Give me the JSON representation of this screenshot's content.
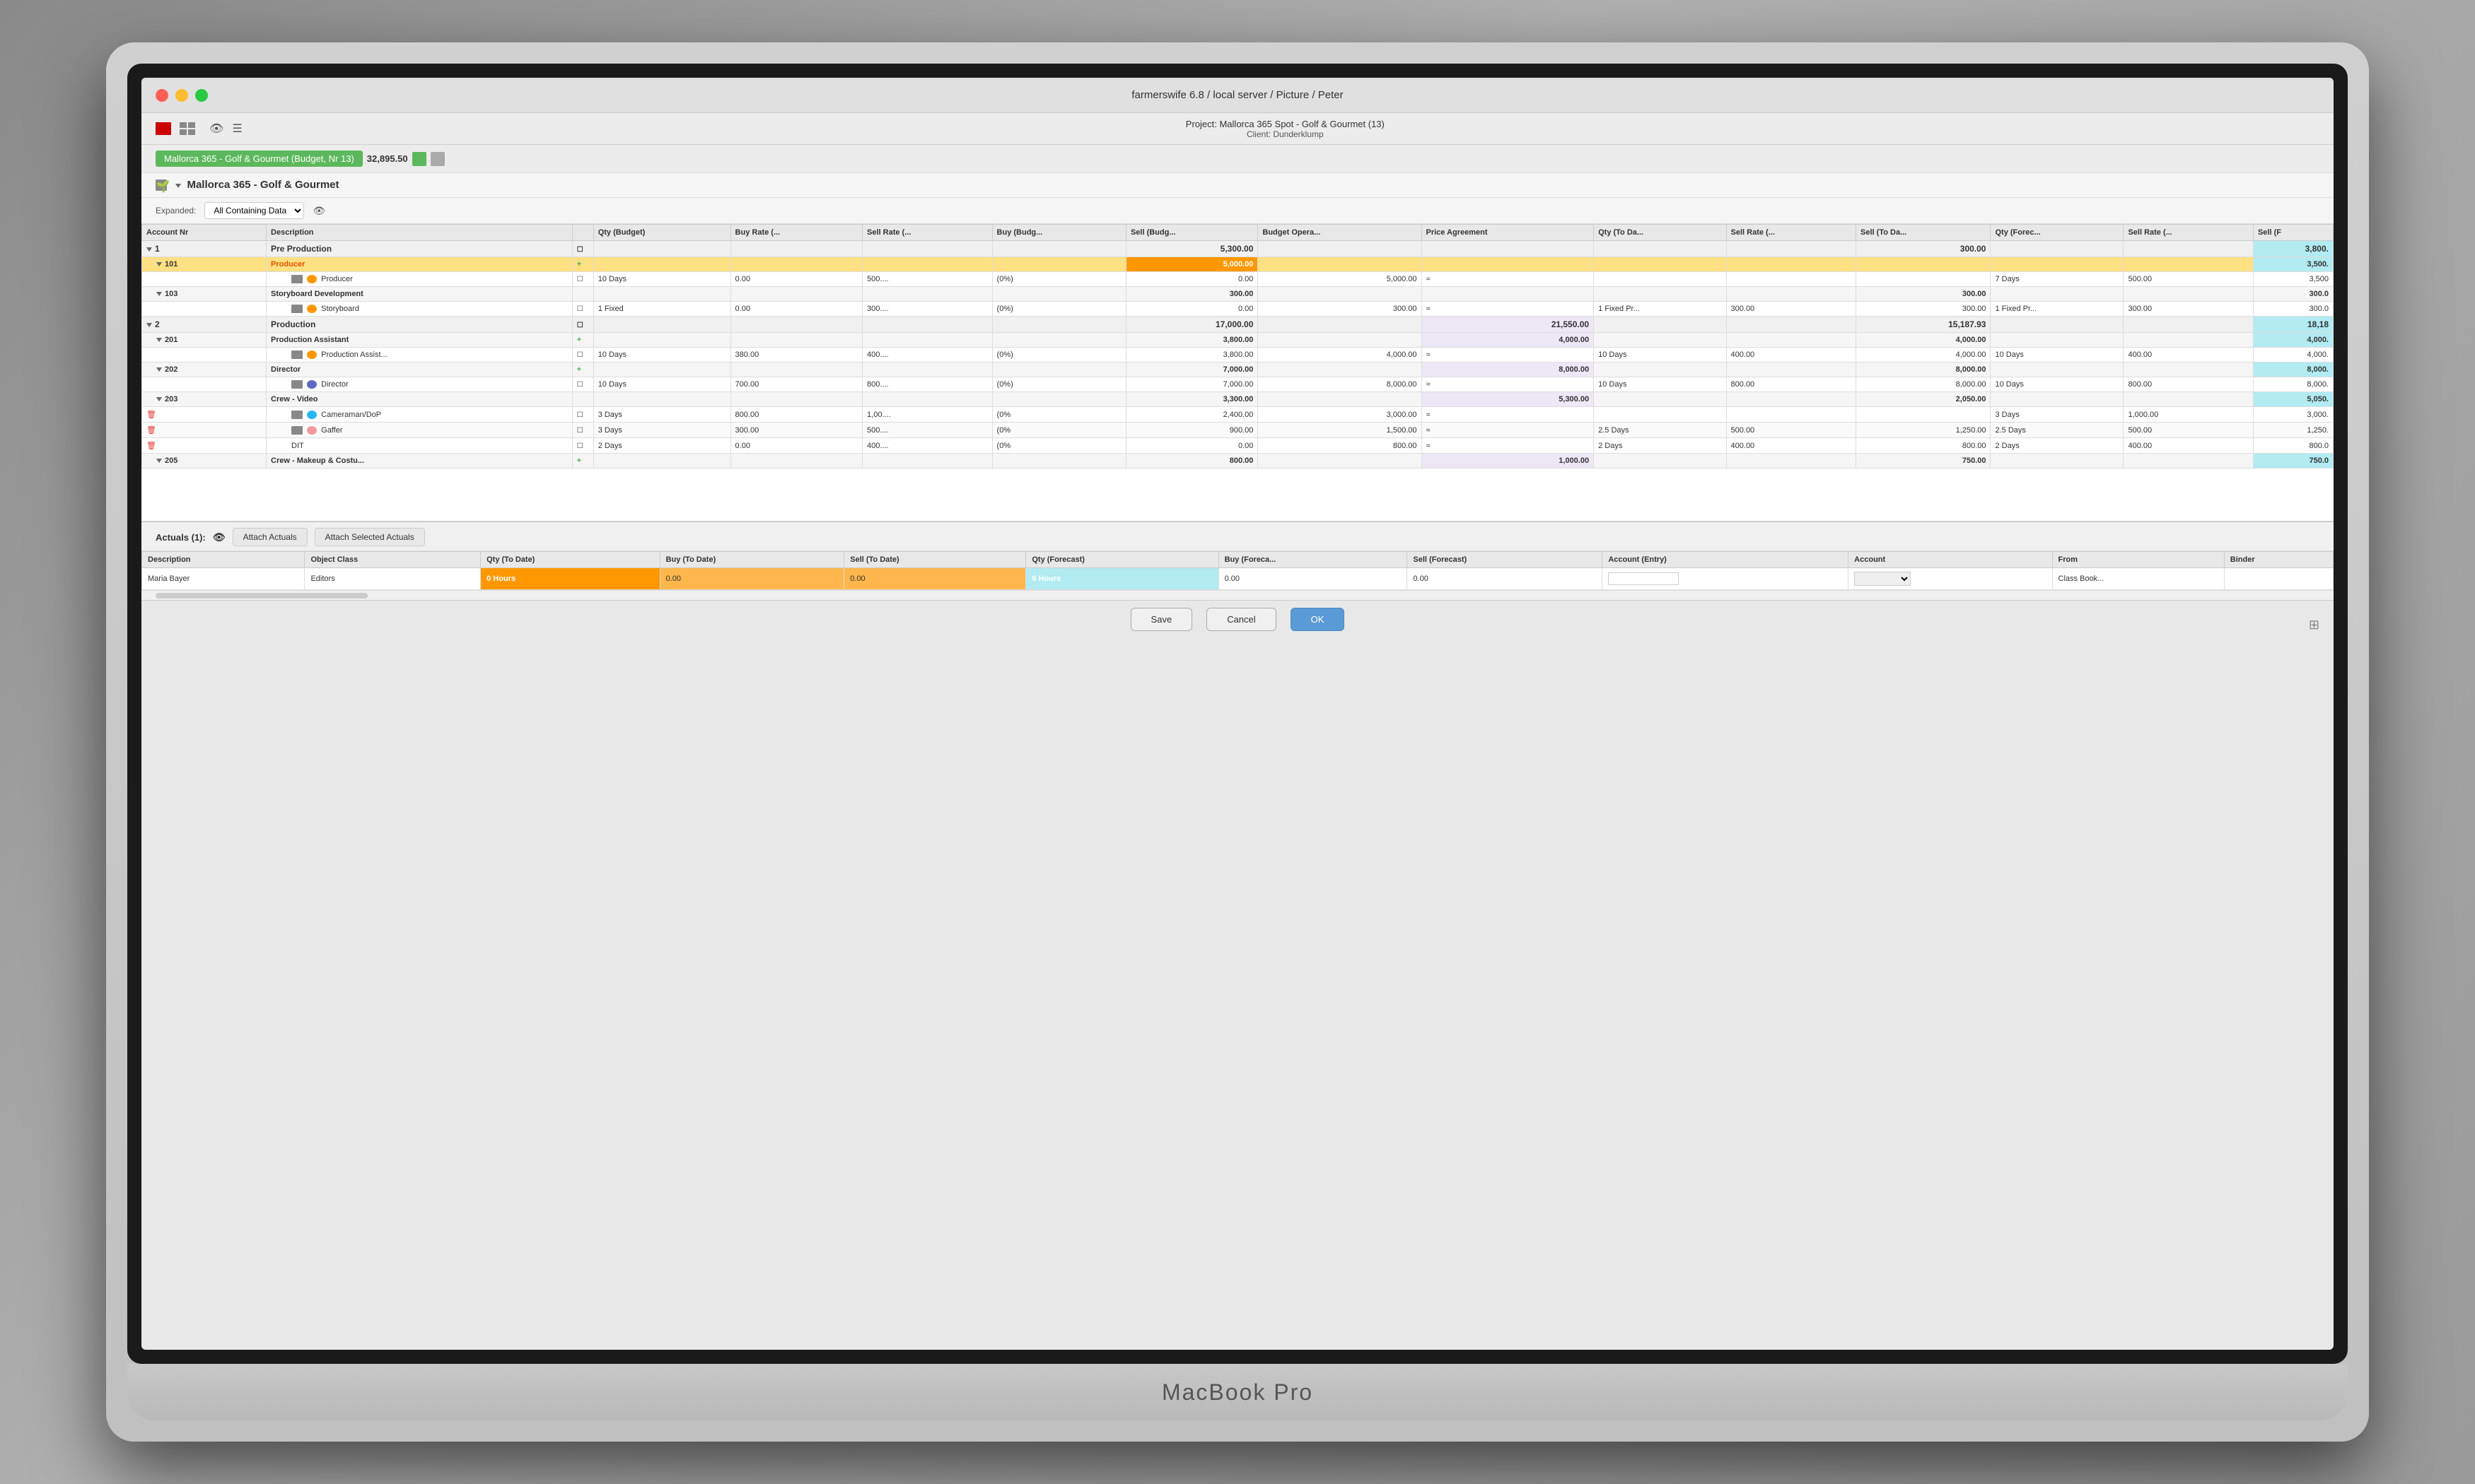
{
  "window": {
    "title": "farmerswife 6.8  / local server / Picture / Peter",
    "project_line1": "Project: Mallorca 365 Spot - Golf & Gourmet (13)",
    "project_line2": "Client: Dunderklump"
  },
  "toolbar": {
    "icons": [
      "red-square-icon",
      "grid-icon",
      "eye-icon",
      "list-icon"
    ]
  },
  "budget": {
    "tag_label": "Mallorca 365 - Golf & Gourmet (Budget, Nr 13)",
    "amount": "32,895.50"
  },
  "section": {
    "title": "Mallorca 365 - Golf & Gourmet"
  },
  "filter": {
    "expanded_label": "Expanded:",
    "option": "All Containing Data",
    "eye_icon": "👁"
  },
  "columns": {
    "headers": [
      "Account Nr",
      "Description",
      "",
      "Qty (Budget)",
      "Buy Rate (...",
      "Sell Rate (...",
      "Buy (Budg...",
      "Sell (Budg...",
      "Budget Opera...",
      "Price Agreement",
      "Qty (To Da...",
      "Sell Rate (...",
      "Sell (To Da...",
      "Qty (Forec...",
      "Sell Rate (... ",
      "Sell (F"
    ]
  },
  "rows": [
    {
      "type": "section",
      "id": "1",
      "description": "Pre Production",
      "sell_budget": "5,300.00",
      "sell_to_date": "300.00",
      "sell_forecast": "3,800."
    },
    {
      "type": "category",
      "id": "101",
      "description": "Producer",
      "sell_budget": "5,000.00",
      "sell_forecast": "3,500."
    },
    {
      "type": "item",
      "description": "Producer",
      "qty_budget": "10",
      "unit": "Days",
      "buy_rate": "0.00",
      "sell_rate": "500....",
      "pct": "(0%)",
      "buy_budget": "0.00",
      "sell_budget": "5,000.00",
      "qty_forecast": "7 Days",
      "sell_rate_f": "500.00",
      "sell_forecast": "3,500"
    },
    {
      "type": "sub_section",
      "id": "103",
      "description": "Storyboard Development",
      "sell_budget": "300.00",
      "sell_to_date": "300.00",
      "sell_forecast": "300.0"
    },
    {
      "type": "item",
      "description": "Storyboard",
      "qty_budget": "1",
      "unit": "Fixed",
      "buy_rate": "0.00",
      "sell_rate": "300....",
      "pct": "(0%)",
      "buy_budget": "0.00",
      "sell_budget": "300.00",
      "qty_to_date": "1 Fixed Pr...",
      "sell_rate_td": "300.00",
      "sell_to_date": "300.00",
      "qty_forecast": "1 Fixed Pr...",
      "sell_rate_f": "300.00",
      "sell_forecast": "300.0"
    },
    {
      "type": "section",
      "id": "2",
      "description": "Production",
      "sell_budget": "17,000.00",
      "sell_budget2": "21,550.00",
      "sell_to_date": "15,187.93",
      "sell_forecast": "18,18"
    },
    {
      "type": "sub_section",
      "id": "201",
      "description": "Production Assistant",
      "sell_budget": "3,800.00",
      "sell_budget2": "4,000.00",
      "sell_to_date": "4,000.00",
      "sell_forecast": "4,000."
    },
    {
      "type": "item",
      "description": "Production Assist...",
      "qty_budget": "10",
      "unit": "Days",
      "buy_rate": "380.00",
      "sell_rate": "400....",
      "pct": "(0%)",
      "buy_budget": "3,800.00",
      "sell_budget": "4,000.00",
      "qty_to_date": "10 Days",
      "sell_rate_td": "400.00",
      "sell_to_date": "4,000.00",
      "qty_forecast": "10 Days",
      "sell_rate_f": "400.00",
      "sell_forecast": "4,000."
    },
    {
      "type": "sub_section",
      "id": "202",
      "description": "Director",
      "sell_budget": "7,000.00",
      "sell_budget2": "8,000.00",
      "sell_to_date": "8,000.00",
      "sell_forecast": "8,000."
    },
    {
      "type": "item",
      "description": "Director",
      "qty_budget": "10",
      "unit": "Days",
      "buy_rate": "700.00",
      "sell_rate": "800....",
      "pct": "(0%)",
      "buy_budget": "7,000.00",
      "sell_budget": "8,000.00",
      "qty_to_date": "10 Days",
      "sell_rate_td": "800.00",
      "sell_to_date": "8,000.00",
      "qty_forecast": "10 Days",
      "sell_rate_f": "800.00",
      "sell_forecast": "8,000."
    },
    {
      "type": "sub_section",
      "id": "203",
      "description": "Crew - Video",
      "sell_budget": "3,300.00",
      "sell_budget2": "5,300.00",
      "sell_to_date": "2,050.00",
      "sell_forecast": "5,050."
    },
    {
      "type": "item",
      "description": "Cameraman/DoP",
      "qty_budget": "3",
      "unit": "Days",
      "buy_rate": "800.00",
      "sell_rate": "1,00....",
      "pct": "(0%",
      "buy_budget": "2,400.00",
      "sell_budget": "3,000.00",
      "qty_forecast": "3 Days",
      "sell_rate_f": "1,000.00",
      "sell_forecast": "3,000."
    },
    {
      "type": "item",
      "description": "Gaffer",
      "qty_budget": "3",
      "unit": "Days",
      "buy_rate": "300.00",
      "sell_rate": "500....",
      "pct": "(0%",
      "buy_budget": "900.00",
      "sell_budget": "1,500.00",
      "qty_to_date": "2.5 Days",
      "sell_rate_td": "500.00",
      "sell_to_date": "1,250.00",
      "qty_forecast": "2.5 Days",
      "sell_rate_f": "500.00",
      "sell_forecast": "1,250."
    },
    {
      "type": "item",
      "description": "DIT",
      "qty_budget": "2",
      "unit": "Days",
      "buy_rate": "0.00",
      "sell_rate": "400....",
      "pct": "(0%",
      "buy_budget": "0.00",
      "sell_budget": "800.00",
      "qty_to_date": "2 Days",
      "sell_rate_td": "400.00",
      "sell_to_date": "800.00",
      "qty_forecast": "2 Days",
      "sell_rate_f": "400.00",
      "sell_forecast": "800.0"
    },
    {
      "type": "sub_section",
      "id": "205",
      "description": "Crew - Makeup & Costu...",
      "sell_budget": "800.00",
      "sell_budget2": "1,000.00",
      "sell_to_date": "750.00",
      "sell_forecast": "750.0"
    }
  ],
  "actuals": {
    "header": "Actuals (1):",
    "search_placeholder": "",
    "btn_attach": "Attach Actuals",
    "btn_attach_selected": "Attach Selected Actuals",
    "columns": [
      "Description",
      "Object Class",
      "Qty (To Date)",
      "Buy (To Date)",
      "Sell (To Date)",
      "Qty (Forecast)",
      "Buy (Foreca...",
      "Sell (Forecast)",
      "Account (Entry)",
      "Account",
      "From",
      "Binder"
    ],
    "rows": [
      {
        "description": "Maria Bayer",
        "object_class": "Editors",
        "qty_to_date": "0 Hours",
        "buy_to_date": "0.00",
        "sell_to_date": "0.00",
        "qty_forecast": "8 Hours",
        "buy_forecast": "0.00",
        "sell_forecast": "0.00",
        "account_entry": "",
        "account": "",
        "from": "Class Book...",
        "binder": ""
      }
    ]
  },
  "buttons": {
    "save": "Save",
    "cancel": "Cancel",
    "ok": "OK"
  },
  "macbook_label": "MacBook Pro"
}
